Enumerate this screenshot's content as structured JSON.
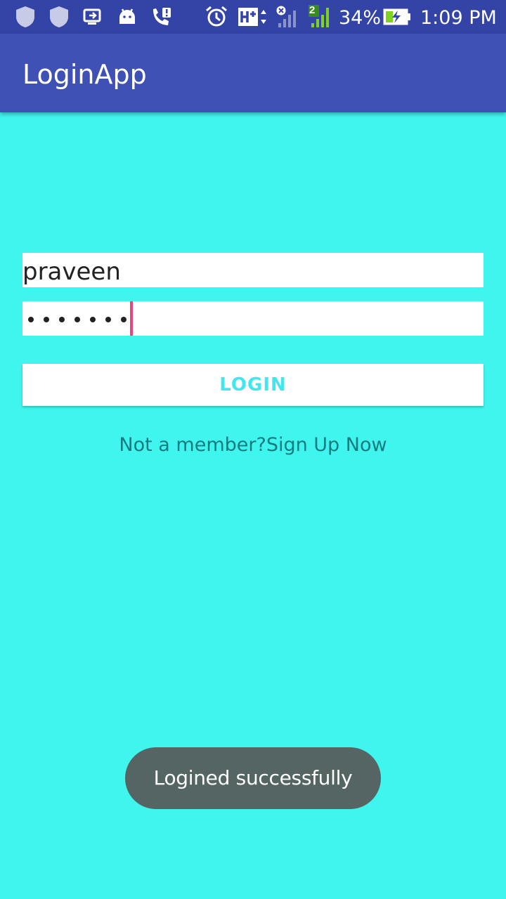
{
  "status_bar": {
    "signal_badge": "2",
    "battery_percent": "34%",
    "time": "1:09 PM",
    "icons": [
      "shield-icon",
      "shield-icon",
      "cast-icon",
      "android-icon",
      "missed-call-icon",
      "alarm-icon",
      "h-plus-network-icon",
      "signal-x-icon",
      "signal-sim2-icon",
      "battery-charging-icon"
    ]
  },
  "app_bar": {
    "title": "LoginApp"
  },
  "login_form": {
    "username_value": "praveen",
    "password_length": 7,
    "login_label": "LOGIN",
    "signup_link": "Not a member?Sign Up Now"
  },
  "toast": {
    "message": "Logined successfully"
  },
  "colors": {
    "status_bar": "#3343a6",
    "app_bar": "#3f51b5",
    "background": "#41f5ef",
    "login_text": "#41e6ef",
    "link_text": "#137c80",
    "cursor": "#e8457e",
    "toast_bg": "#556563"
  }
}
